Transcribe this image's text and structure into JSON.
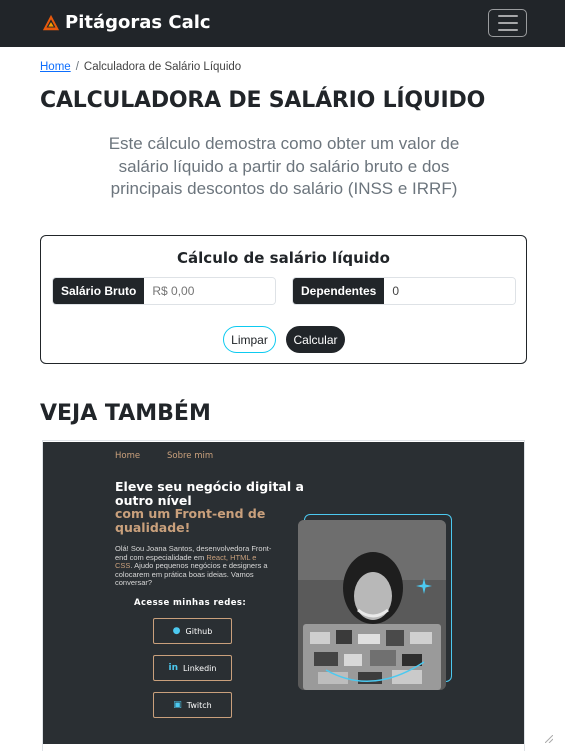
{
  "navbar": {
    "brand": "Pitágoras Calc",
    "brand_icon": "pyramid-logo-icon",
    "menu_icon": "hamburger-menu-icon"
  },
  "breadcrumb": {
    "home": "Home",
    "separator": "/",
    "current": "Calculadora de Salário Líquido"
  },
  "page": {
    "title": "CALCULADORA DE SALÁRIO LÍQUIDO",
    "lead": "Este cálculo demostra como obter um valor de salário líquido a partir do salário bruto e dos principais descontos do salário (INSS e IRRF)"
  },
  "calculator": {
    "title": "Cálculo de salário líquido",
    "salary_label": "Salário Bruto",
    "salary_placeholder": "R$ 0,00",
    "dependents_label": "Dependentes",
    "dependents_value": "0",
    "clear_label": "Limpar",
    "calc_label": "Calcular"
  },
  "see_also": {
    "title": "VEJA TAMBÉM",
    "preview": {
      "nav": [
        "Home",
        "Sobre mim"
      ],
      "headline_1": "Eleve seu negócio digital a outro nível",
      "headline_2": "com um Front-end de qualidade!",
      "para_1": "Olá! Sou Joana Santos, desenvolvedora Front-end com especialidade em ",
      "para_hl": "React, HTML e CSS",
      "para_2": ". Ajudo pequenos negócios e designers a colocarem em prática boas ideias. Vamos conversar?",
      "social_title": "Acesse minhas redes:",
      "social": [
        {
          "label": "Github",
          "icon": "github-icon"
        },
        {
          "label": "Linkedin",
          "icon": "linkedin-icon"
        },
        {
          "label": "Twitch",
          "icon": "twitch-icon"
        }
      ]
    }
  },
  "colors": {
    "dark": "#212529",
    "accent_cyan": "#0dcaf0",
    "preview_bg": "#2a2f33",
    "preview_accent": "#c9a07c",
    "link": "#0d6efd"
  }
}
